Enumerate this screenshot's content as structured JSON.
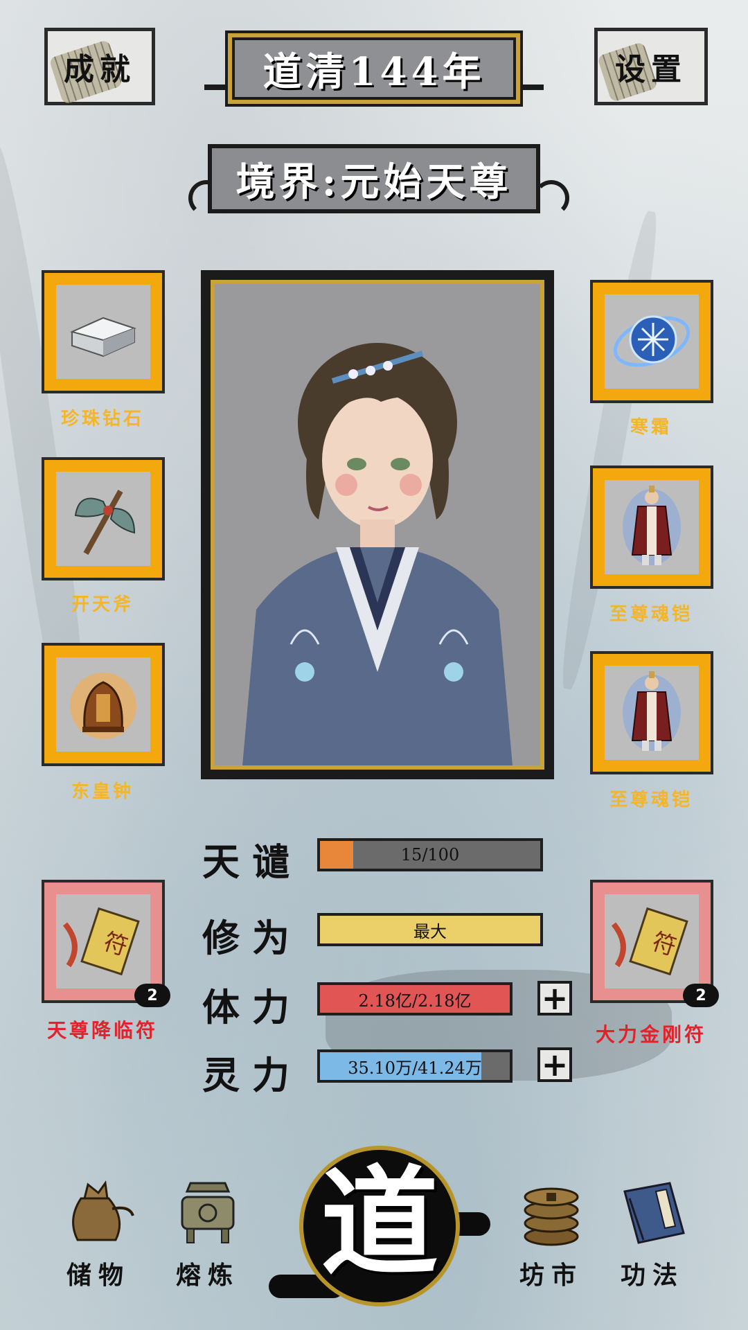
{
  "header": {
    "achievements_label": "成就",
    "year_label": "道清144年",
    "settings_label": "设置",
    "realm_label": "境界:元始天尊"
  },
  "equipment_left": [
    {
      "name": "珍珠钻石",
      "icon": "crystal-ingot-icon"
    },
    {
      "name": "开天斧",
      "icon": "battle-axe-icon"
    },
    {
      "name": "东皇钟",
      "icon": "bronze-bell-icon"
    }
  ],
  "equipment_right": [
    {
      "name": "寒霜",
      "icon": "frost-orb-icon"
    },
    {
      "name": "至尊魂铠",
      "icon": "sage-robe-icon"
    },
    {
      "name": "至尊魂铠",
      "icon": "sage-robe-icon"
    }
  ],
  "talismans": {
    "left": {
      "name": "天尊降临符",
      "count": "2",
      "icon": "talisman-scroll-icon"
    },
    "right": {
      "name": "大力金刚符",
      "count": "2",
      "icon": "talisman-scroll-icon"
    }
  },
  "stats": {
    "tribulation": {
      "label": "天谴",
      "value": "15/100",
      "fraction": 0.15,
      "color": "#e8873a"
    },
    "cultivation": {
      "label": "修为",
      "value": "最大",
      "fraction": 1.0,
      "color": "#ebd06a"
    },
    "stamina": {
      "label": "体力",
      "value": "2.18亿/2.18亿",
      "fraction": 1.0,
      "color": "#e25555"
    },
    "spirit": {
      "label": "灵力",
      "value": "35.10万/41.24万",
      "fraction": 0.85,
      "color": "#7cb9e6"
    }
  },
  "nav": {
    "storage_label": "储物",
    "smelting_label": "熔炼",
    "dao_label": "道",
    "market_label": "坊市",
    "techniques_label": "功法"
  }
}
